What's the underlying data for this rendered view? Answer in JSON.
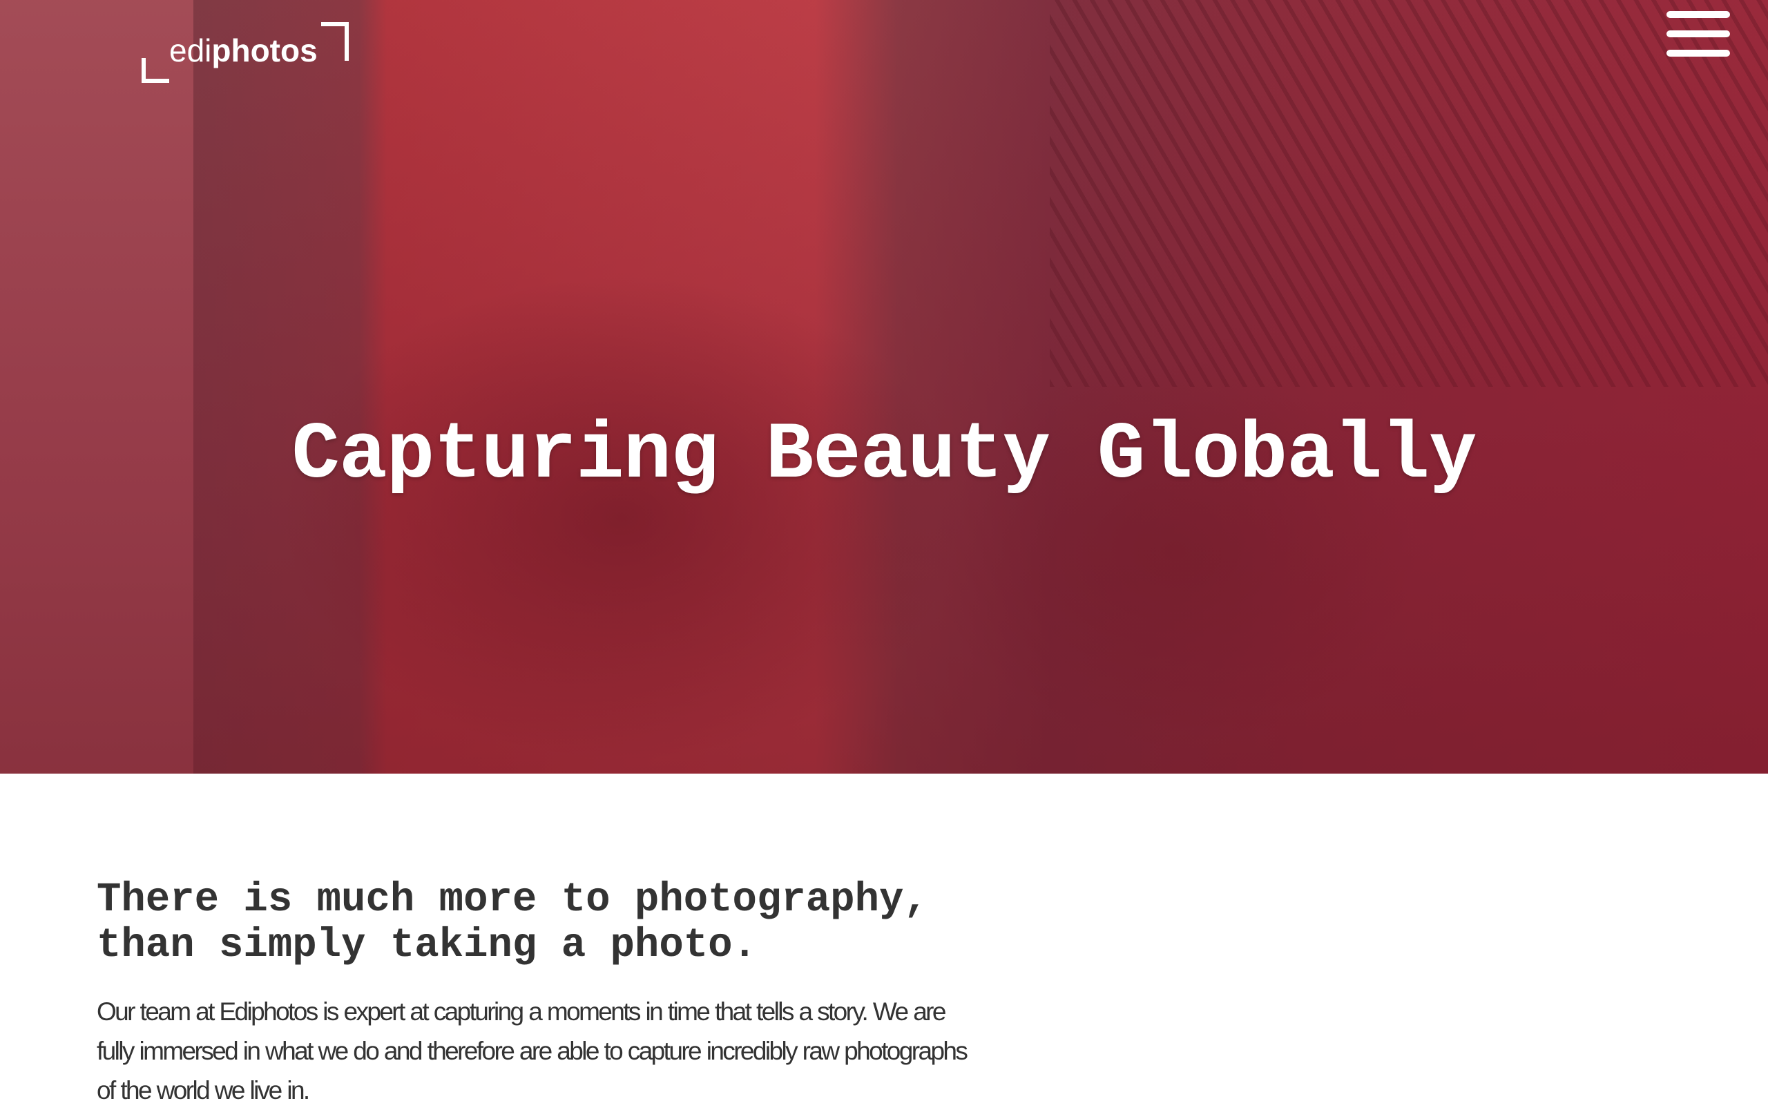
{
  "header": {
    "logo_light": "edi",
    "logo_bold": "photos",
    "menu_icon": "hamburger-icon"
  },
  "hero": {
    "title": "Capturing Beauty Globally"
  },
  "intro": {
    "heading_line1": "There is much more to photography,",
    "heading_line2": "than simply taking a photo.",
    "body": "Our team at Ediphotos is expert at capturing a moments in time that tells a story. We are fully immersed in what we do and therefore are able to capture incredibly raw photographs of the world we live in."
  },
  "colors": {
    "hero_tint": "#9a2a3c",
    "text": "#333333"
  }
}
